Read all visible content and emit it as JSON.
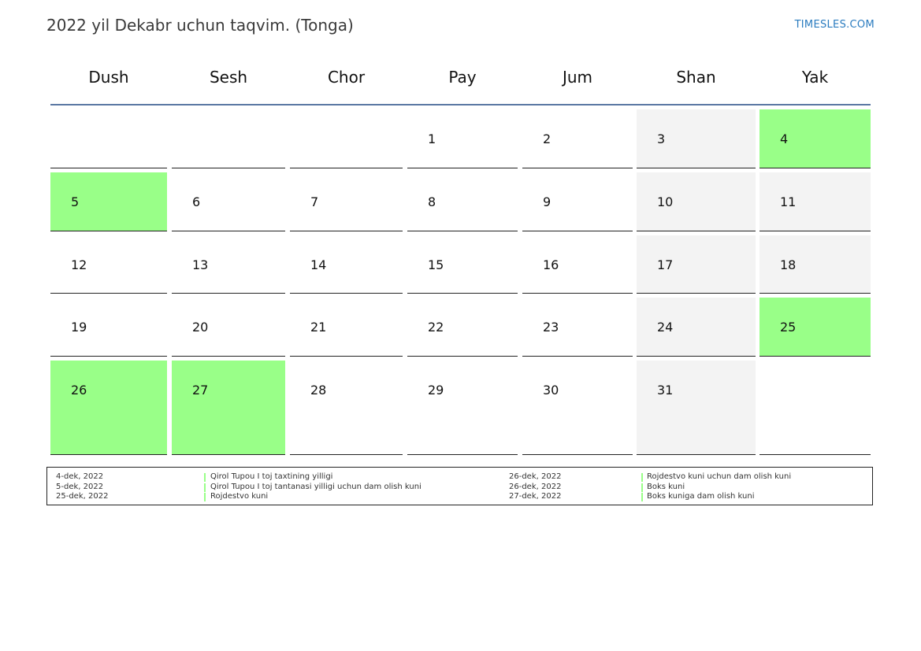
{
  "header": {
    "title": "2022 yil Dekabr uchun taqvim. (Tonga)",
    "brand": "TIMESLES.COM"
  },
  "colors": {
    "holiday": "#99ff88",
    "weekend": "#f3f3f3",
    "header_rule": "#5a77a3",
    "brand": "#2a7bbf"
  },
  "weekdays": [
    "Dush",
    "Sesh",
    "Chor",
    "Pay",
    "Jum",
    "Shan",
    "Yak"
  ],
  "weeks": [
    [
      null,
      null,
      null,
      1,
      2,
      3,
      4
    ],
    [
      5,
      6,
      7,
      8,
      9,
      10,
      11
    ],
    [
      12,
      13,
      14,
      15,
      16,
      17,
      18
    ],
    [
      19,
      20,
      21,
      22,
      23,
      24,
      25
    ],
    [
      26,
      27,
      28,
      29,
      30,
      31,
      null
    ]
  ],
  "holiday_days": [
    4,
    5,
    25,
    26,
    27
  ],
  "legend": {
    "left": [
      {
        "date": "4-dek, 2022",
        "name": "Qirol Tupou I toj taxtining yilligi"
      },
      {
        "date": "5-dek, 2022",
        "name": "Qirol Tupou I toj tantanasi yilligi uchun dam olish kuni"
      },
      {
        "date": "25-dek, 2022",
        "name": "Rojdestvo kuni"
      }
    ],
    "right": [
      {
        "date": "26-dek, 2022",
        "name": "Rojdestvo kuni uchun dam olish kuni"
      },
      {
        "date": "26-dek, 2022",
        "name": "Boks kuni"
      },
      {
        "date": "27-dek, 2022",
        "name": "Boks kuniga dam olish kuni"
      }
    ]
  }
}
